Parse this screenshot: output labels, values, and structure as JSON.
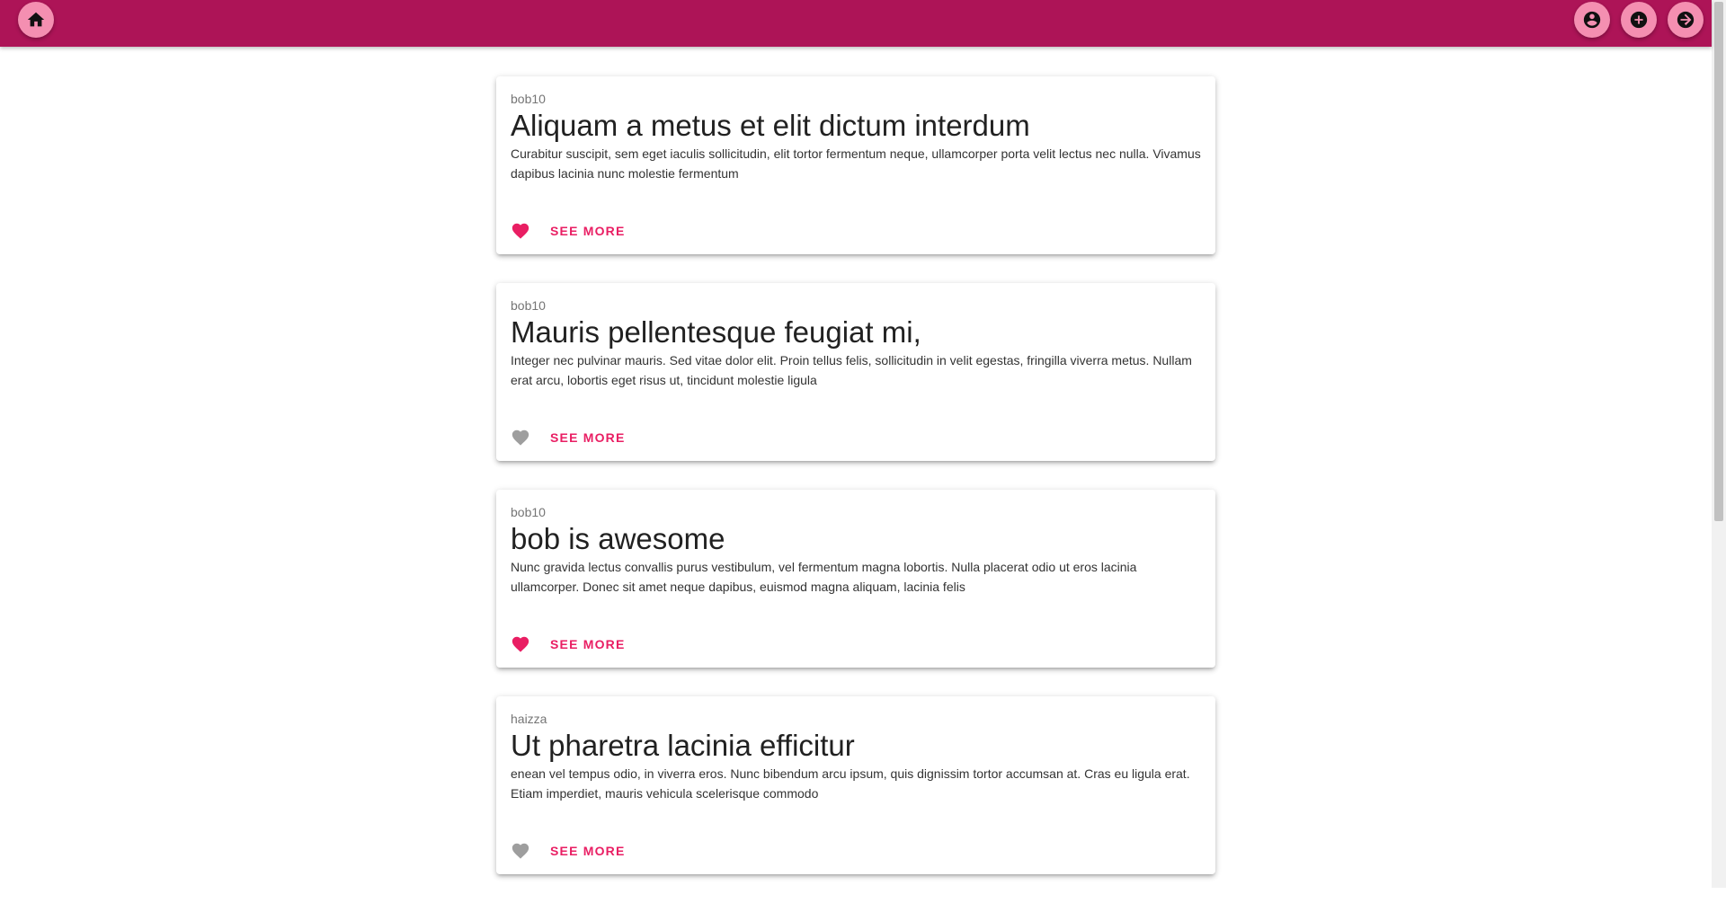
{
  "colors": {
    "appbar": "#ad1457",
    "fab": "#f48fb1",
    "accent": "#e91e63",
    "heart_liked": "#e91e63",
    "heart_unliked": "#9e9e9e"
  },
  "appbar": {
    "left_icon": "home-icon",
    "right_icons": [
      "account-circle-icon",
      "add-circle-icon",
      "arrow-forward-circle-icon"
    ]
  },
  "posts": [
    {
      "author": "bob10",
      "title": "Aliquam a metus et elit dictum interdum",
      "body": "Curabitur suscipit, sem eget iaculis sollicitudin, elit tortor fermentum neque, ullamcorper porta velit lectus nec nulla. Vivamus dapibus lacinia nunc molestie fermentum",
      "liked": true,
      "action_label": "SEE MORE"
    },
    {
      "author": "bob10",
      "title": "Mauris pellentesque feugiat mi,",
      "body": "Integer nec pulvinar mauris. Sed vitae dolor elit. Proin tellus felis, sollicitudin in velit egestas, fringilla viverra metus. Nullam erat arcu, lobortis eget risus ut, tincidunt molestie ligula",
      "liked": false,
      "action_label": "SEE MORE"
    },
    {
      "author": "bob10",
      "title": "bob is awesome",
      "body": "Nunc gravida lectus convallis purus vestibulum, vel fermentum magna lobortis. Nulla placerat odio ut eros lacinia ullamcorper. Donec sit amet neque dapibus, euismod magna aliquam, lacinia felis",
      "liked": true,
      "action_label": "SEE MORE"
    },
    {
      "author": "haizza",
      "title": "Ut pharetra lacinia efficitur",
      "body": "enean vel tempus odio, in viverra eros. Nunc bibendum arcu ipsum, quis dignissim tortor accumsan at. Cras eu ligula erat. Etiam imperdiet, mauris vehicula scelerisque commodo",
      "liked": false,
      "action_label": "SEE MORE"
    }
  ]
}
